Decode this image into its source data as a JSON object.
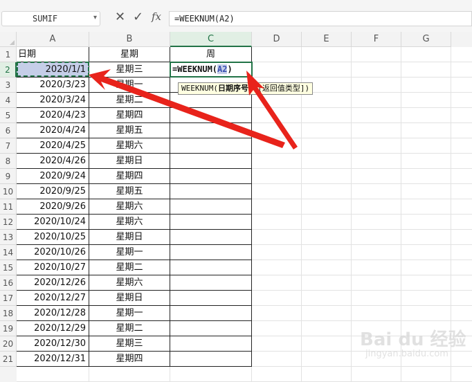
{
  "formula_bar": {
    "name_box": "SUMIF",
    "cancel_icon": "close-icon",
    "confirm_icon": "check-icon",
    "fx_label": "fx",
    "formula": "=WEEKNUM(A2)"
  },
  "columns": [
    "A",
    "B",
    "C",
    "D",
    "E",
    "F",
    "G"
  ],
  "rows": [
    "1",
    "2",
    "3",
    "4",
    "5",
    "6",
    "7",
    "8",
    "9",
    "10",
    "11",
    "12",
    "13",
    "14",
    "15",
    "16",
    "17",
    "18",
    "19",
    "20",
    "21"
  ],
  "headers": {
    "a": "日期",
    "b": "星期",
    "c": "周"
  },
  "data_rows": [
    {
      "date": "2020/1/1",
      "weekday": "星期三"
    },
    {
      "date": "2020/3/23",
      "weekday": "星期一"
    },
    {
      "date": "2020/3/24",
      "weekday": "星期二"
    },
    {
      "date": "2020/4/23",
      "weekday": "星期四"
    },
    {
      "date": "2020/4/24",
      "weekday": "星期五"
    },
    {
      "date": "2020/4/25",
      "weekday": "星期六"
    },
    {
      "date": "2020/4/26",
      "weekday": "星期日"
    },
    {
      "date": "2020/9/24",
      "weekday": "星期四"
    },
    {
      "date": "2020/9/25",
      "weekday": "星期五"
    },
    {
      "date": "2020/9/26",
      "weekday": "星期六"
    },
    {
      "date": "2020/10/24",
      "weekday": "星期六"
    },
    {
      "date": "2020/10/25",
      "weekday": "星期日"
    },
    {
      "date": "2020/10/26",
      "weekday": "星期一"
    },
    {
      "date": "2020/10/27",
      "weekday": "星期二"
    },
    {
      "date": "2020/12/26",
      "weekday": "星期六"
    },
    {
      "date": "2020/12/27",
      "weekday": "星期日"
    },
    {
      "date": "2020/12/28",
      "weekday": "星期一"
    },
    {
      "date": "2020/12/29",
      "weekday": "星期二"
    },
    {
      "date": "2020/12/30",
      "weekday": "星期三"
    },
    {
      "date": "2020/12/31",
      "weekday": "星期四"
    }
  ],
  "edit_cell": {
    "prefix": "=WEEKNUM(",
    "ref": "A2",
    "suffix": ")"
  },
  "tooltip": {
    "fn": "WEEKNUM",
    "open": "(",
    "arg1": "日期序号",
    "sep": ", ",
    "arg2": "[返回值类型]",
    "close": ")"
  },
  "watermark": {
    "brand": "Bai du 经验",
    "sub": "jingyan.baidu.com"
  },
  "colors": {
    "accent": "#217346",
    "selection": "#c5cee8",
    "arrow": "#e8231b",
    "tooltip_bg": "#ffffe1"
  }
}
